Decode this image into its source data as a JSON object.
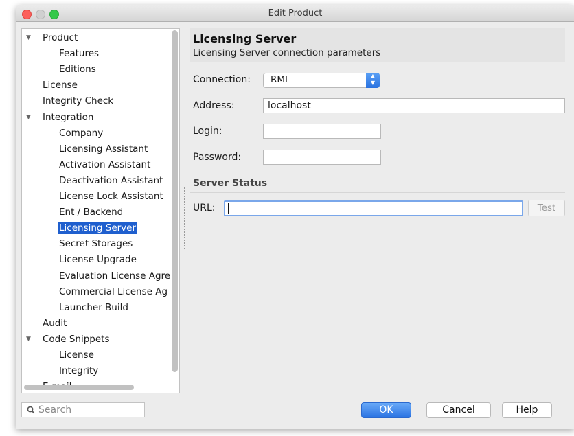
{
  "window": {
    "title": "Edit Product"
  },
  "tree": {
    "items": [
      {
        "label": "Product",
        "expanded": true,
        "indent": 0
      },
      {
        "label": "Features",
        "indent": 1
      },
      {
        "label": "Editions",
        "indent": 1
      },
      {
        "label": "License",
        "indent": 0
      },
      {
        "label": "Integrity Check",
        "indent": 0
      },
      {
        "label": "Integration",
        "expanded": true,
        "indent": 0
      },
      {
        "label": "Company",
        "indent": 1
      },
      {
        "label": "Licensing Assistant",
        "indent": 1
      },
      {
        "label": "Activation Assistant",
        "indent": 1
      },
      {
        "label": "Deactivation Assistant",
        "indent": 1
      },
      {
        "label": "License Lock Assistant",
        "indent": 1
      },
      {
        "label": "Ent / Backend",
        "indent": 1
      },
      {
        "label": "Licensing Server",
        "indent": 1,
        "selected": true
      },
      {
        "label": "Secret Storages",
        "indent": 1
      },
      {
        "label": "License Upgrade",
        "indent": 1
      },
      {
        "label": "Evaluation License Agre",
        "indent": 1
      },
      {
        "label": "Commercial License Ag",
        "indent": 1
      },
      {
        "label": "Launcher Build",
        "indent": 1
      },
      {
        "label": "Audit",
        "indent": 0
      },
      {
        "label": "Code Snippets",
        "expanded": true,
        "indent": 0
      },
      {
        "label": "License",
        "indent": 1
      },
      {
        "label": "Integrity",
        "indent": 1
      },
      {
        "label": "E-mail",
        "indent": 0
      }
    ]
  },
  "panel": {
    "title": "Licensing Server",
    "subtitle": "Licensing Server connection parameters",
    "connection_label": "Connection:",
    "connection_value": "RMI",
    "address_label": "Address:",
    "address_value": "localhost",
    "login_label": "Login:",
    "login_value": "",
    "password_label": "Password:",
    "password_value": "",
    "server_status_label": "Server Status",
    "url_label": "URL:",
    "url_value": "",
    "test_label": "Test"
  },
  "footer": {
    "search_placeholder": "Search",
    "ok_label": "OK",
    "cancel_label": "Cancel",
    "help_label": "Help"
  },
  "colors": {
    "selection": "#1f5fce",
    "primary_button": "#2b73e2",
    "focus_ring": "#7aa7ea"
  }
}
